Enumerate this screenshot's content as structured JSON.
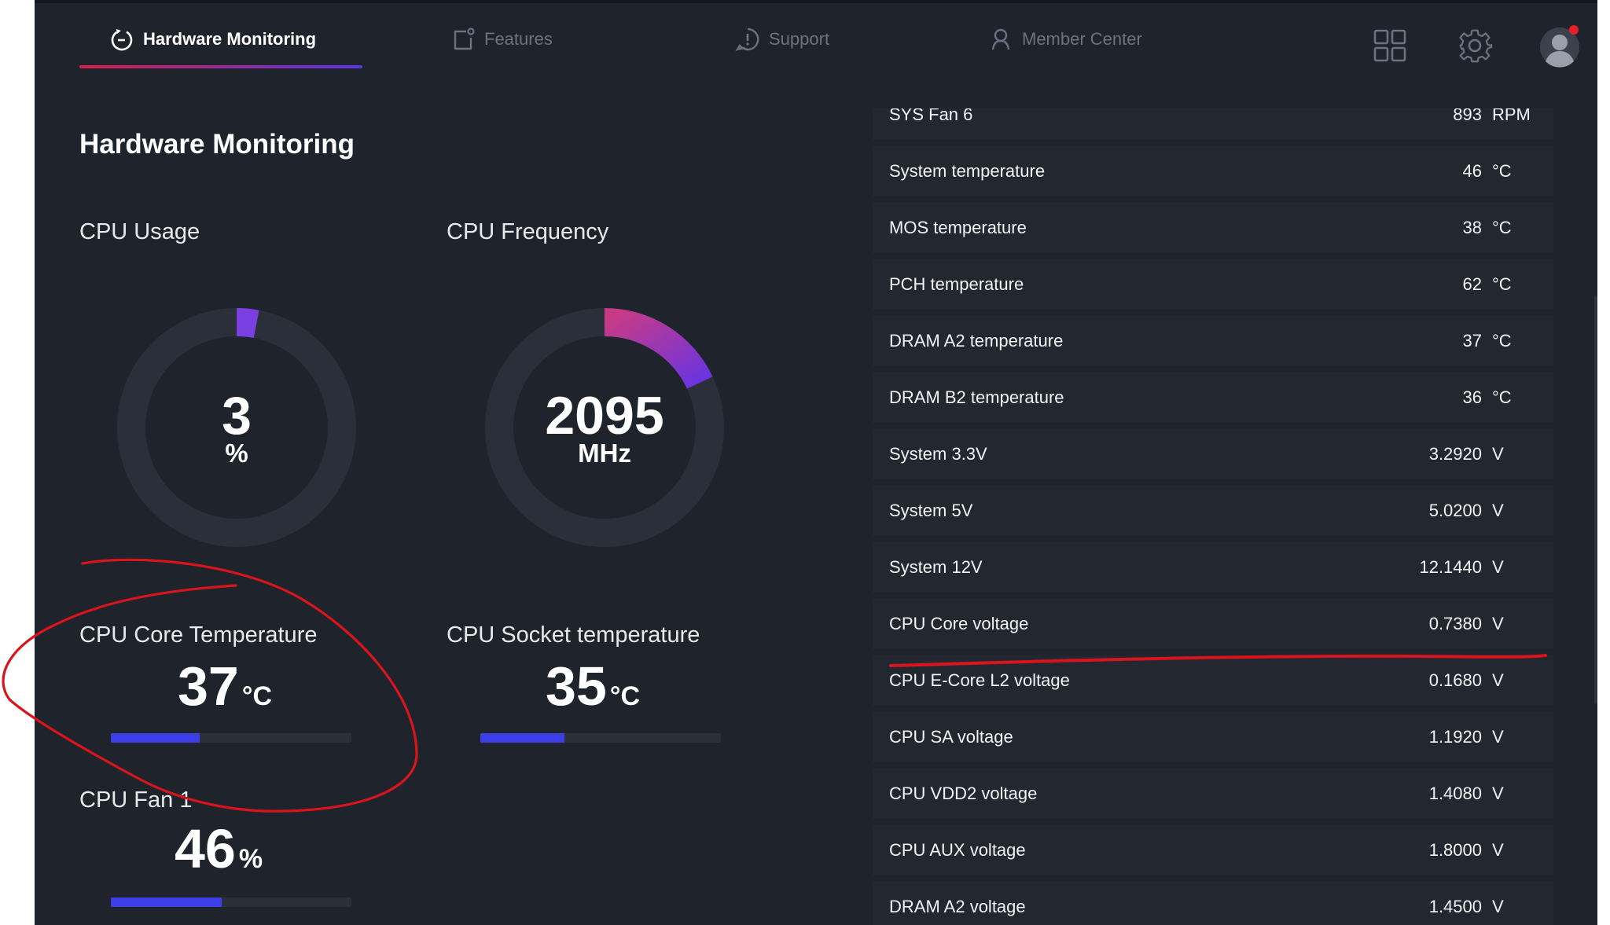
{
  "nav": {
    "tabs": [
      {
        "label": "Hardware Monitoring",
        "icon": "refresh-icon",
        "active": true
      },
      {
        "label": "Features",
        "icon": "features-icon",
        "active": false
      },
      {
        "label": "Support",
        "icon": "support-icon",
        "active": false
      },
      {
        "label": "Member Center",
        "icon": "member-icon",
        "active": false
      }
    ],
    "right_icons": [
      "grid-icon",
      "gear-icon",
      "avatar"
    ]
  },
  "page_title": "Hardware Monitoring",
  "cpu_usage": {
    "label": "CPU Usage",
    "value": "3",
    "unit": "%",
    "percent": 3
  },
  "cpu_frequency": {
    "label": "CPU Frequency",
    "value": "2095",
    "unit": "MHz",
    "fraction": 0.18
  },
  "cpu_core_temp": {
    "label": "CPU Core Temperature",
    "value": "37",
    "unit": "°C",
    "percent": 37
  },
  "cpu_socket_temp": {
    "label": "CPU Socket temperature",
    "value": "35",
    "unit": "°C",
    "percent": 35
  },
  "cpu_fan": {
    "label": "CPU Fan 1",
    "value": "46",
    "unit": "%",
    "percent": 46
  },
  "sensors": [
    {
      "name": "SYS Fan 6",
      "value": "893",
      "unit": "RPM"
    },
    {
      "name": "System temperature",
      "value": "46",
      "unit": "°C"
    },
    {
      "name": "MOS temperature",
      "value": "38",
      "unit": "°C"
    },
    {
      "name": "PCH temperature",
      "value": "62",
      "unit": "°C"
    },
    {
      "name": "DRAM A2 temperature",
      "value": "37",
      "unit": "°C"
    },
    {
      "name": "DRAM B2 temperature",
      "value": "36",
      "unit": "°C"
    },
    {
      "name": "System 3.3V",
      "value": "3.2920",
      "unit": "V"
    },
    {
      "name": "System 5V",
      "value": "5.0200",
      "unit": "V"
    },
    {
      "name": "System 12V",
      "value": "12.1440",
      "unit": "V"
    },
    {
      "name": "CPU Core voltage",
      "value": "0.7380",
      "unit": "V"
    },
    {
      "name": "CPU E-Core L2 voltage",
      "value": "0.1680",
      "unit": "V"
    },
    {
      "name": "CPU SA voltage",
      "value": "1.1920",
      "unit": "V"
    },
    {
      "name": "CPU VDD2 voltage",
      "value": "1.4080",
      "unit": "V"
    },
    {
      "name": "CPU AUX voltage",
      "value": "1.8000",
      "unit": "V"
    },
    {
      "name": "DRAM A2 voltage",
      "value": "1.4500",
      "unit": "V"
    }
  ],
  "colors": {
    "background": "#1f232b",
    "row": "#232730",
    "bar_fill": "#3d3fe6",
    "accent_start": "#d8204a",
    "accent_end": "#5b36e6",
    "annotation": "#d8141c"
  }
}
